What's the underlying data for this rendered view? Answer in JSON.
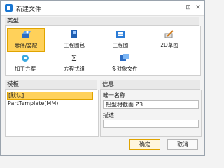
{
  "window": {
    "title": "新建文件"
  },
  "sections": {
    "type_label": "类型",
    "template_label": "模板",
    "info_label": "信息"
  },
  "types": [
    {
      "label": "零件/装配",
      "icon": "part-assembly-icon",
      "selected": true
    },
    {
      "label": "工程图包",
      "icon": "drawing-package-icon",
      "selected": false
    },
    {
      "label": "工程图",
      "icon": "drawing-icon",
      "selected": false
    },
    {
      "label": "2D草图",
      "icon": "sketch-2d-icon",
      "selected": false
    },
    {
      "label": "加工方案",
      "icon": "machining-plan-icon",
      "selected": false
    },
    {
      "label": "方程式组",
      "icon": "equation-set-icon",
      "selected": false
    },
    {
      "label": "多对象文件",
      "icon": "multi-object-file-icon",
      "selected": false
    }
  ],
  "templates": [
    {
      "label": "[默认]",
      "selected": true
    },
    {
      "label": "PartTemplate(MM)",
      "selected": false
    }
  ],
  "info": {
    "name_label": "唯一名称",
    "name_value": "铝型材截面 Z3",
    "description_label": "描述",
    "description_value": ""
  },
  "buttons": {
    "ok": "确定",
    "cancel": "取消"
  },
  "colors": {
    "selected_bg": "#ffd15a",
    "accent_blue": "#1976d2"
  }
}
